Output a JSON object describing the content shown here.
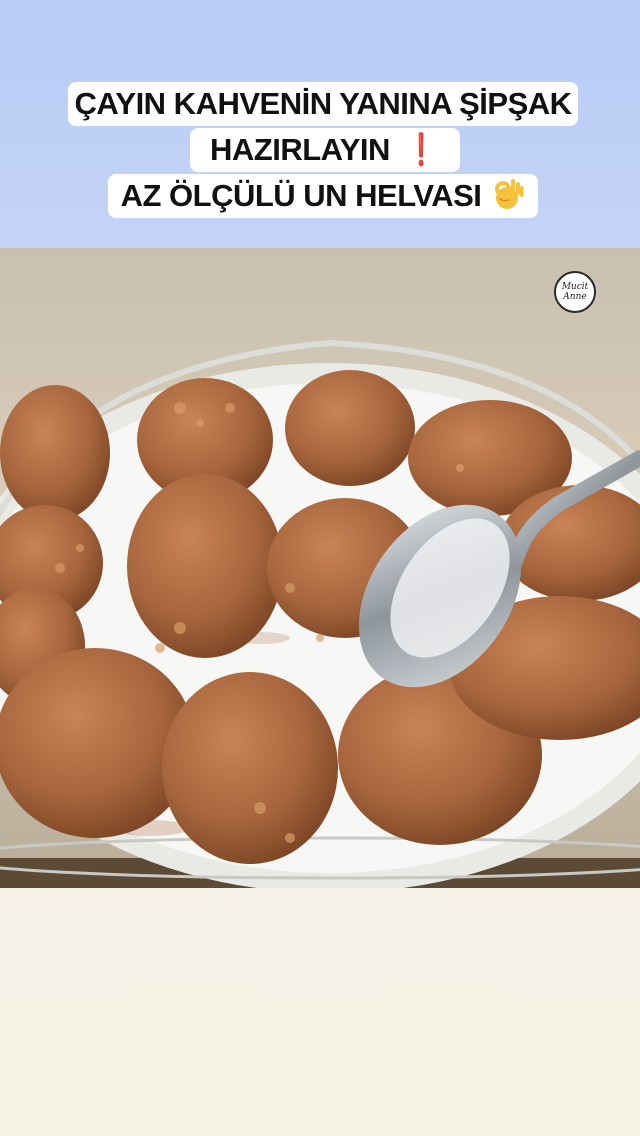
{
  "caption": {
    "line1": "ÇAYIN KAHVENİN YANINA ŞİPŞAK",
    "line2": "HAZIRLAYIN",
    "line3": "AZ ÖLÇÜLÜ UN HELVASI",
    "exclamation_emoji": "❗",
    "ok_hand_icon": "ok-hand-emoji"
  },
  "logo": {
    "line1": "Mucit",
    "line2": "Anne"
  },
  "colors": {
    "header_background": "#c1d2f6",
    "caption_box": "#ffffff",
    "caption_text": "#111111",
    "helva_brown": "#a8663d",
    "plate_white": "#f7f7f5"
  }
}
